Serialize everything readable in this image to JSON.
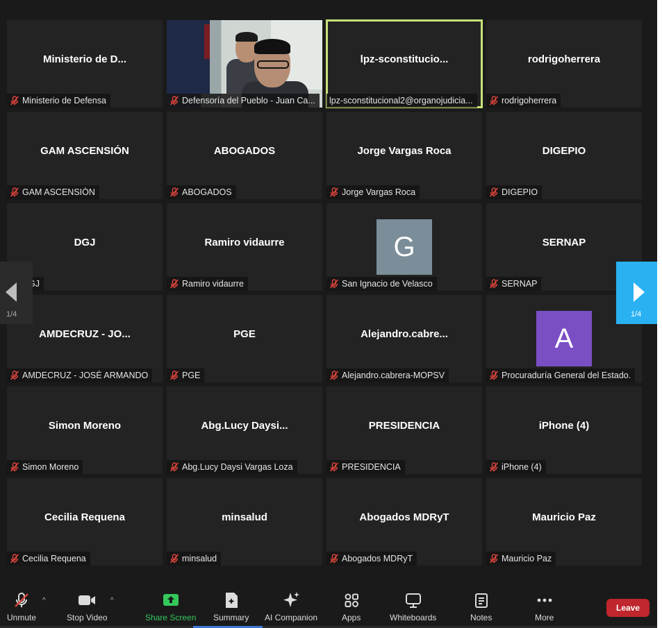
{
  "tiles": [
    {
      "title": "Ministerio de D...",
      "name": "Ministerio de Defensa"
    },
    {
      "title": "",
      "name": "Defensoría del Pueblo - Juan Ca...",
      "video": true
    },
    {
      "title": "lpz-sconstitucio...",
      "name": "lpz-sconstitucional2@organojudicia...",
      "active": true,
      "no_mic": true
    },
    {
      "title": "rodrigoherrera",
      "name": "rodrigoherrera"
    },
    {
      "title": "GAM ASCENSIÓN",
      "name": "GAM ASCENSIÓN"
    },
    {
      "title": "ABOGADOS",
      "name": "ABOGADOS"
    },
    {
      "title": "Jorge Vargas Roca",
      "name": "Jorge Vargas Roca"
    },
    {
      "title": "DIGEPIO",
      "name": "DIGEPIO"
    },
    {
      "title": "DGJ",
      "name": "DGJ"
    },
    {
      "title": "Ramiro vidaurre",
      "name": "Ramiro vidaurre"
    },
    {
      "title": "",
      "name": "San Ignacio de Velasco",
      "avatar": "G",
      "avatar_color": "#7a8d99"
    },
    {
      "title": "SERNAP",
      "name": "SERNAP"
    },
    {
      "title": "AMDECRUZ - JO...",
      "name": "AMDECRUZ - JOSÉ ARMANDO"
    },
    {
      "title": "PGE",
      "name": "PGE"
    },
    {
      "title": "Alejandro.cabre...",
      "name": "Alejandro.cabrera-MOPSV"
    },
    {
      "title": "",
      "name": "Procuraduría General del Estado.",
      "avatar": "A",
      "avatar_color": "#7b4fc4"
    },
    {
      "title": "Simon Moreno",
      "name": "Simon Moreno"
    },
    {
      "title": "Abg.Lucy Daysi...",
      "name": "Abg.Lucy Daysi Vargas Loza"
    },
    {
      "title": "PRESIDENCIA",
      "name": "PRESIDENCIA"
    },
    {
      "title": "iPhone (4)",
      "name": "iPhone (4)"
    },
    {
      "title": "Cecilia Requena",
      "name": "Cecilia Requena"
    },
    {
      "title": "minsalud",
      "name": "minsalud"
    },
    {
      "title": "Abogados MDRyT",
      "name": "Abogados MDRyT"
    },
    {
      "title": "Mauricio Paz",
      "name": "Mauricio Paz"
    }
  ],
  "pagination": {
    "left": "1/4",
    "right": "1/4"
  },
  "toolbar": {
    "unmute": "Unmute",
    "stop_video": "Stop Video",
    "share_screen": "Share Screen",
    "summary": "Summary",
    "ai_companion": "AI Companion",
    "apps": "Apps",
    "whiteboards": "Whiteboards",
    "notes": "Notes",
    "more": "More",
    "leave": "Leave"
  },
  "colors": {
    "accent_blue": "#2ab1f2",
    "share_green": "#35c85a",
    "leave_red": "#c0262d",
    "muted_red": "#e0453c",
    "active_border": "#c8e27a"
  }
}
